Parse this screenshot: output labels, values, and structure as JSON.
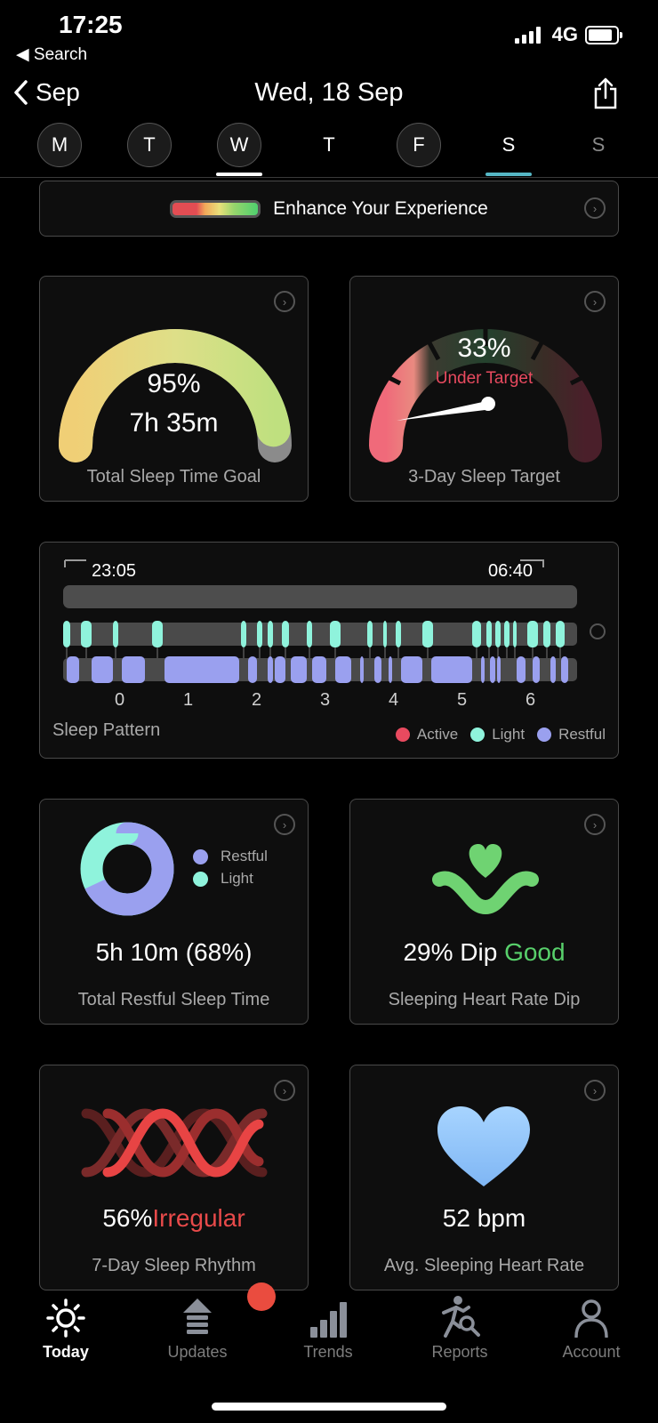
{
  "status": {
    "time": "17:25",
    "back": "◀ Search",
    "network": "4G"
  },
  "nav": {
    "back": "Sep",
    "title": "Wed, 18 Sep"
  },
  "days": [
    {
      "letter": "M"
    },
    {
      "letter": "T"
    },
    {
      "letter": "W"
    },
    {
      "letter": "T"
    },
    {
      "letter": "F"
    },
    {
      "letter": "S"
    },
    {
      "letter": "S"
    }
  ],
  "colors": {
    "accent_teal": "#56b7c5",
    "restful": "#9aa0ef",
    "light": "#8ff3dc",
    "active": "#e84a5f",
    "good": "#58d06b",
    "irregular": "#e84a4a"
  },
  "enhance": {
    "label": "Enhance Your Experience"
  },
  "sleep_goal": {
    "percent": "95%",
    "duration": "7h 35m",
    "label": "Total Sleep Time Goal",
    "fraction": 0.95
  },
  "sleep_target": {
    "percent": "33%",
    "status": "Under Target",
    "label": "3-Day Sleep Target",
    "fraction": 0.33
  },
  "pattern": {
    "start": "23:05",
    "end": "06:40",
    "label": "Sleep Pattern",
    "hours": [
      "0",
      "1",
      "2",
      "3",
      "4",
      "5",
      "6"
    ],
    "legend": {
      "active": "Active",
      "light": "Light",
      "restful": "Restful"
    }
  },
  "restful": {
    "value": "5h 10m (68%)",
    "label": "Total Restful Sleep Time",
    "legend_restful": "Restful",
    "legend_light": "Light",
    "restful_fraction": 0.68
  },
  "heart_dip": {
    "value": "29% Dip",
    "status": "Good",
    "label": "Sleeping Heart Rate Dip"
  },
  "rhythm": {
    "value": "56%",
    "status": "Irregular",
    "label": "7-Day Sleep Rhythm"
  },
  "heart_rate": {
    "value": "52 bpm",
    "label": "Avg. Sleeping Heart Rate"
  },
  "tabs": [
    {
      "label": "Today",
      "icon": "sun-icon"
    },
    {
      "label": "Updates",
      "icon": "updates-icon"
    },
    {
      "label": "Trends",
      "icon": "bar-chart-icon"
    },
    {
      "label": "Reports",
      "icon": "reports-icon"
    },
    {
      "label": "Account",
      "icon": "person-icon"
    }
  ]
}
